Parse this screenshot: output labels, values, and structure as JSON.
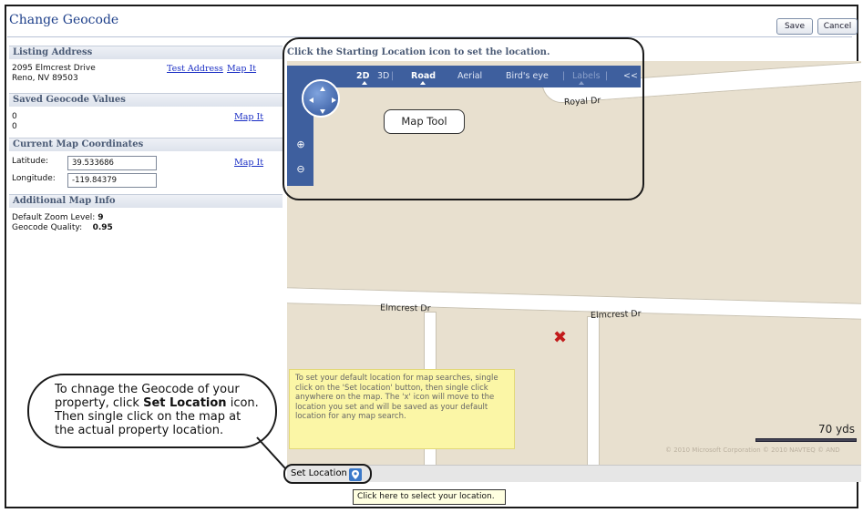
{
  "header": {
    "title": "Change Geocode",
    "save_label": "Save",
    "cancel_label": "Cancel"
  },
  "listing_address": {
    "heading": "Listing Address",
    "line1": "2095 Elmcrest Drive",
    "line2": "Reno, NV 89503",
    "test_link": "Test Address",
    "map_link": "Map It"
  },
  "saved_geocode": {
    "heading": "Saved Geocode Values",
    "value1": "0",
    "value2": "0",
    "map_link": "Map It"
  },
  "current_coords": {
    "heading": "Current Map Coordinates",
    "lat_label": "Latitude:",
    "lat_value": "39.533686",
    "lon_label": "Longitude:",
    "lon_value": "-119.84379",
    "map_link": "Map It"
  },
  "additional": {
    "heading": "Additional Map Info",
    "zoom_label": "Default Zoom Level:",
    "zoom_value": "9",
    "quality_label": "Geocode Quality:",
    "quality_value": "0.95"
  },
  "map": {
    "instruction": "Click the Starting Location icon to set the location.",
    "toolbar": {
      "d2": "2D",
      "d3": "3D",
      "road": "Road",
      "aerial": "Aerial",
      "birds": "Bird's eye",
      "labels": "Labels",
      "collapse": "<<"
    },
    "streets": {
      "royal": "Royal Dr",
      "elmcrest_left": "Elmcrest Dr",
      "elmcrest_right": "Elmcrest Dr"
    },
    "tool_callout": "Map Tool",
    "marker_glyph": "✖",
    "tip_text": "To set your default location for map searches, single click on the 'Set location' button, then single click anywhere on the map. The 'x' icon will move to the location you set and will be saved as your default location for any map search.",
    "scale": "70 yds",
    "copyright": "© 2010 Microsoft Corporation   © 2010 NAVTEQ   © AND"
  },
  "callout": {
    "text_before": "To chnage the Geocode of your property, click ",
    "text_bold": "Set Location",
    "text_after": " icon. Then single click on the map at the actual property location."
  },
  "set_location": {
    "label": "Set Location",
    "tooltip": "Click here to select your location."
  },
  "colors": {
    "accent": "#3e5f9e",
    "title": "#1d3f8a",
    "link": "#1a2ec4",
    "marker": "#c21b1b",
    "tip_bg": "#fbf6a6"
  }
}
